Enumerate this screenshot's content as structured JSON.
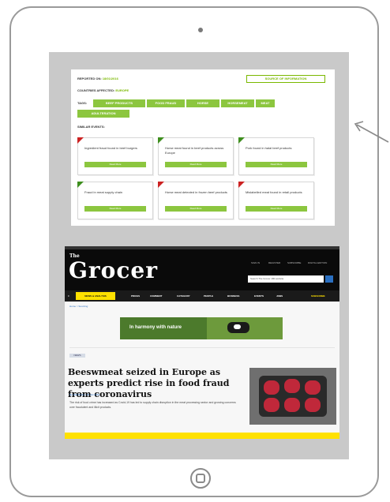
{
  "panel": {
    "reported_on_label": "REPORTED ON:",
    "reported_on_value": "18/01/2016",
    "source_button": "SOURCE OF INFORMATION",
    "countries_label": "COUNTRIES AFFECTED:",
    "countries_value": "EUROPE",
    "tags_label": "TAGS:",
    "tags": [
      "BEEF PRODUCTS",
      "FOOD FRAUD",
      "HORSE",
      "HORSEMEAT",
      "MEAT",
      "ADULTERATION"
    ],
    "similar_label": "SIMILAR EVENTS:",
    "cards": [
      {
        "text": "Ingredient fraud found in beef burgers",
        "button": "Read More",
        "flag": "red"
      },
      {
        "text": "Horse meat found in beef products across Europe",
        "button": "Read More",
        "flag": "green"
      },
      {
        "text": "Pork found in halal beef products",
        "button": "Read More",
        "flag": "green"
      },
      {
        "text": "Fraud in meat supply chain",
        "button": "Read More",
        "flag": "green"
      },
      {
        "text": "Horse meat detected in frozen beef products",
        "button": "Read More",
        "flag": "red"
      },
      {
        "text": "Mislabelled meat found in retail products",
        "button": "Read More",
        "flag": "red"
      }
    ]
  },
  "grocer": {
    "logo_the": "The",
    "logo": "Grocer",
    "top_links": [
      "SIGN IN",
      "REGISTER",
      "SUBSCRIBE",
      "DIGITAL EDITION"
    ],
    "search_placeholder": "Search The Grocer 180 website",
    "nav_yellow": "NEWS & ANALYSIS",
    "nav_items": [
      "PRICES",
      "COMMENT",
      "CATEGORY",
      "PEOPLE",
      "BUSINESS",
      "EVENTS",
      "JOBS"
    ],
    "nav_right": "SUBSCRIBE",
    "breadcrumb": "Home > Sourcing",
    "ad_text": "In harmony with nature",
    "tag": "NEWS",
    "headline": "Beeswmeat seized in Europe as experts predict rise in food fraud from coronavirus",
    "meta": "By Staff Writer | 18 Jan 2016",
    "summary": "The risk of food crime has increased as Covid-19 has led to supply chain disruption in the meat processing sector and growing concerns over fraudulent and illicit products."
  },
  "colors": {
    "accent_green": "#8cc63f",
    "grocer_yellow": "#ffe100",
    "flag_red": "#cc2222",
    "flag_green": "#3e8e1e"
  }
}
